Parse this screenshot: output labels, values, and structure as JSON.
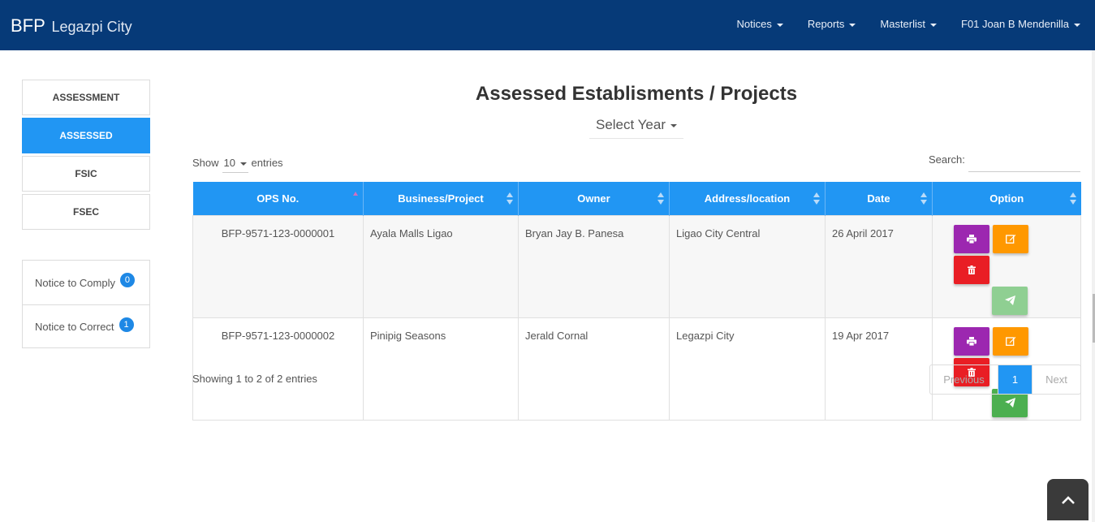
{
  "navbar": {
    "brand": "BFP",
    "brand_sub": "Legazpi City",
    "menu": [
      "Notices",
      "Reports",
      "Masterlist",
      "F01 Joan B Mendenilla"
    ]
  },
  "sidebar": {
    "items": [
      {
        "label": "ASSESSMENT",
        "active": false
      },
      {
        "label": "ASSESSED",
        "active": true
      },
      {
        "label": "FSIC",
        "active": false
      },
      {
        "label": "FSEC",
        "active": false
      }
    ],
    "notices": [
      {
        "label": "Notice to Comply",
        "count": "0"
      },
      {
        "label": "Notice to Correct",
        "count": "1"
      }
    ]
  },
  "main": {
    "title": "Assessed Establisments / Projects",
    "year_select": "Select Year",
    "show_label": "Show",
    "entries_label": "entries",
    "page_length": "10",
    "search_label": "Search:",
    "search_value": "",
    "columns": [
      "OPS No.",
      "Business/Project",
      "Owner",
      "Address/location",
      "Date",
      "Option"
    ],
    "rows": [
      {
        "ops": "BFP-9571-123-0000001",
        "business": "Ayala Malls Ligao",
        "owner": "Bryan Jay B. Panesa",
        "address": "Ligao City Central",
        "date": "26 April 2017"
      },
      {
        "ops": "BFP-9571-123-0000002",
        "business": "Pinipig Seasons",
        "owner": "Jerald Cornal",
        "address": "Legazpi City",
        "date": "19 Apr 2017"
      }
    ],
    "info": "Showing 1 to 2 of 2 entries",
    "pager": {
      "previous": "Previous",
      "current": "1",
      "next": "Next"
    }
  },
  "colors": {
    "navbar": "#063a78",
    "accent": "#2196f3",
    "print": "#9c27b0",
    "edit": "#ff9800",
    "delete": "#e91e24",
    "send": "#4caf50"
  }
}
